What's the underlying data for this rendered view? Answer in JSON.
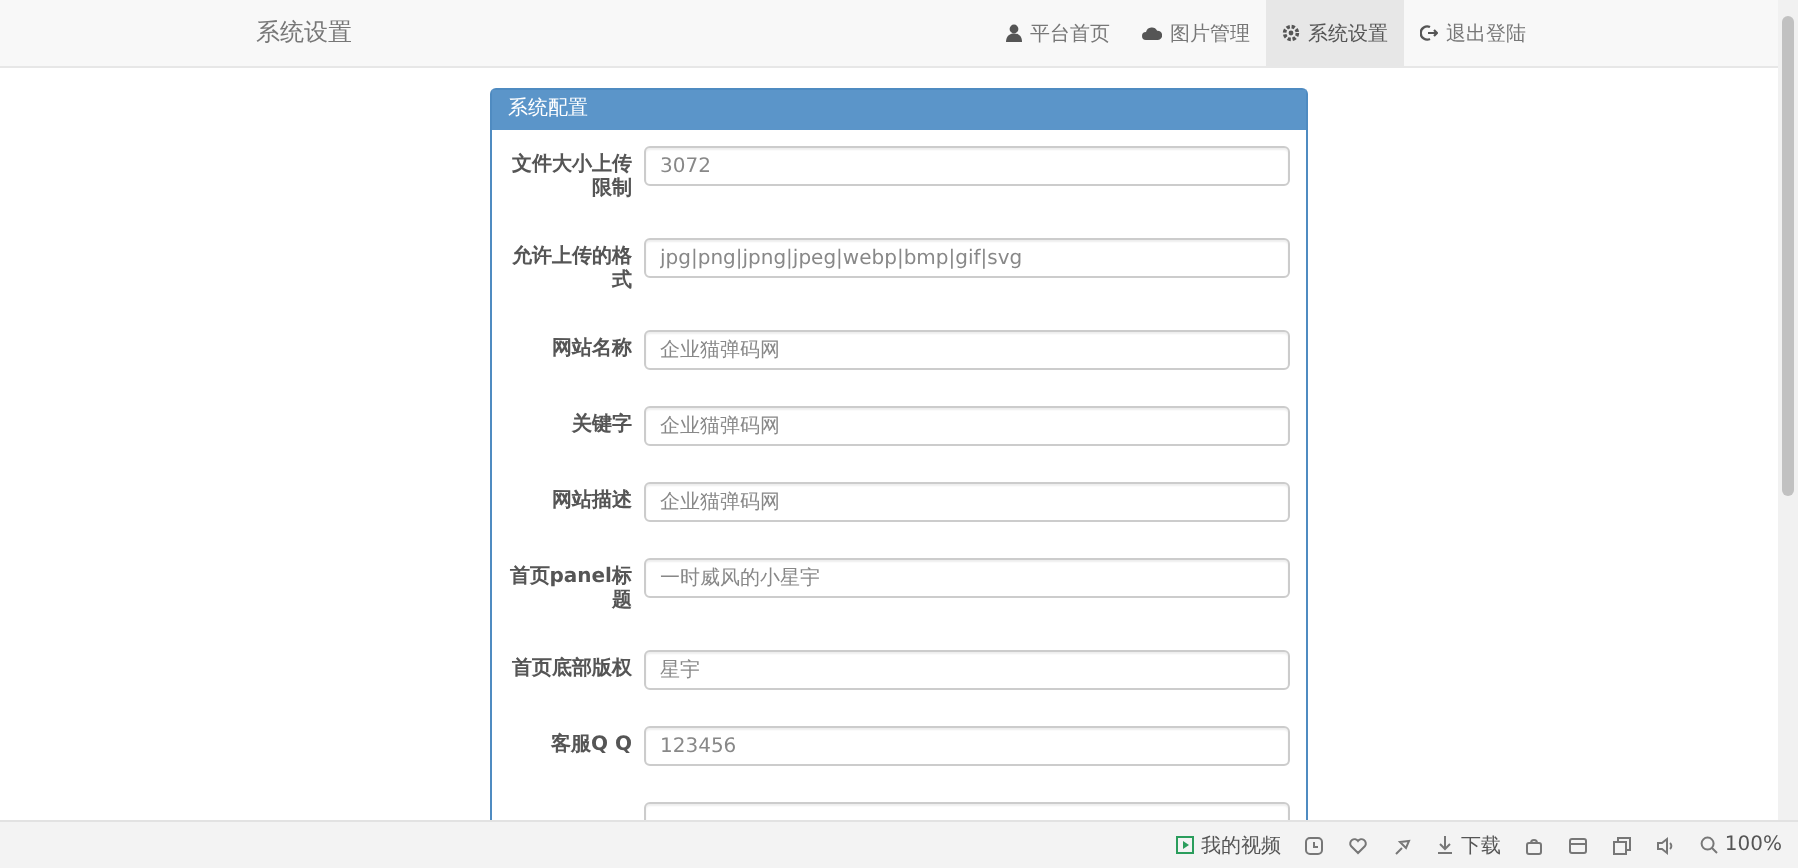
{
  "navbar": {
    "brand": "系统设置",
    "items": [
      {
        "label": "平台首页",
        "selected": false
      },
      {
        "label": "图片管理",
        "selected": false
      },
      {
        "label": "系统设置",
        "selected": true
      },
      {
        "label": "退出登陆",
        "selected": false
      }
    ]
  },
  "panel": {
    "title": "系统配置",
    "fields": [
      {
        "label": "文件大小上传限制",
        "value": "3072"
      },
      {
        "label": "允许上传的格式",
        "value": "jpg|png|jpng|jpeg|webp|bmp|gif|svg"
      },
      {
        "label": "网站名称",
        "value": "企业猫弹码网"
      },
      {
        "label": "关键字",
        "value": "企业猫弹码网"
      },
      {
        "label": "网站描述",
        "value": "企业猫弹码网"
      },
      {
        "label": "首页panel标题",
        "value": "一时威风的小星宇"
      },
      {
        "label": "首页底部版权",
        "value": "星宇"
      },
      {
        "label": "客服Q Q",
        "value": "123456"
      }
    ]
  },
  "status_bar": {
    "items": [
      {
        "kind": "video",
        "label": "我的视频"
      },
      {
        "kind": "download",
        "label": "下载"
      },
      {
        "kind": "zoom",
        "label": "100%"
      }
    ]
  }
}
